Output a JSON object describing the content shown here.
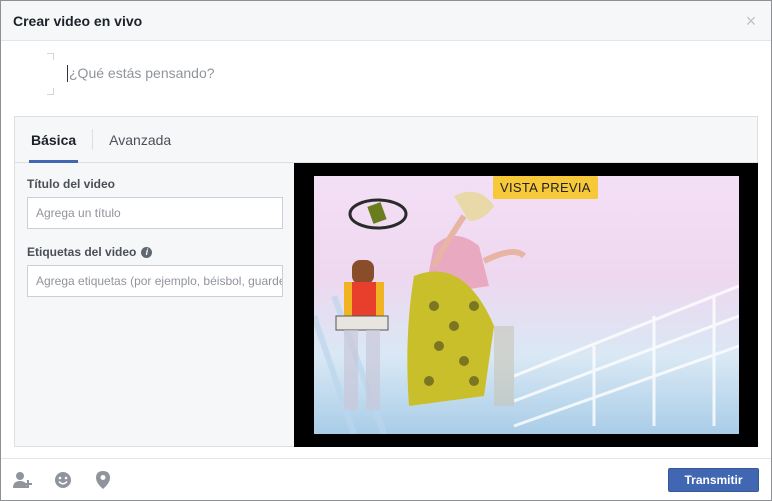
{
  "dialog": {
    "title": "Crear video en vivo",
    "close_symbol": "×"
  },
  "composer": {
    "placeholder": "¿Qué estás pensando?"
  },
  "tabs": [
    {
      "label": "Básica",
      "active": true
    },
    {
      "label": "Avanzada",
      "active": false
    }
  ],
  "form": {
    "title_label": "Título del video",
    "title_placeholder": "Agrega un título",
    "tags_label": "Etiquetas del video",
    "tags_placeholder": "Agrega etiquetas (por ejemplo, béisbol, guardería)"
  },
  "preview": {
    "badge": "VISTA PREVIA"
  },
  "footer": {
    "icons": [
      "tag-people-icon",
      "feeling-icon",
      "location-icon"
    ],
    "submit_label": "Transmitir"
  },
  "colors": {
    "accent": "#4267b2",
    "badge": "#f7c837"
  }
}
